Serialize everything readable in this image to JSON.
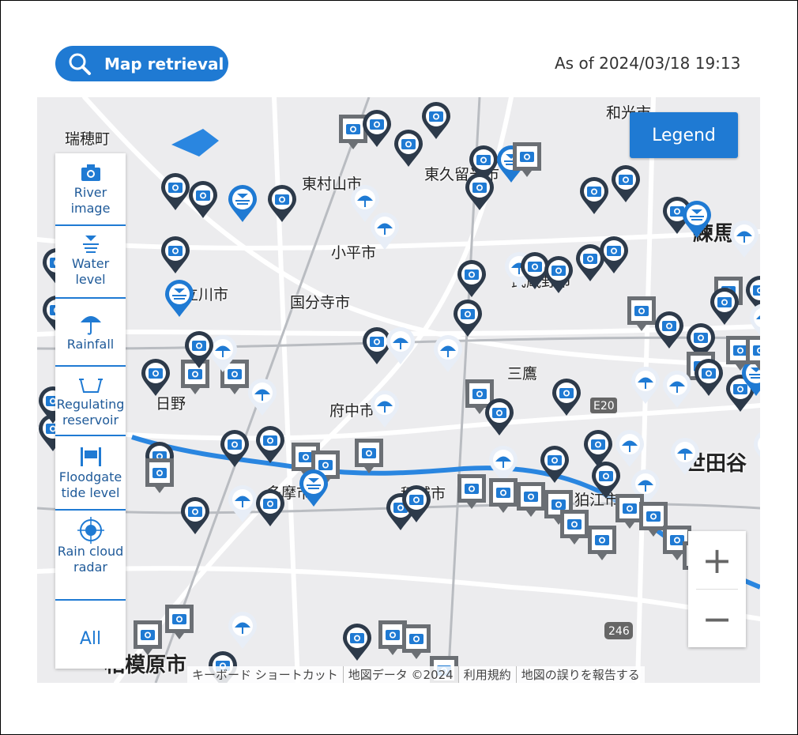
{
  "header": {
    "retrieval_label": "Map retrieval",
    "timestamp": "As of 2024/03/18 19:13"
  },
  "legend_button": "Legend",
  "filters": [
    {
      "label": "River image",
      "icon": "camera-icon"
    },
    {
      "label": "Water level",
      "icon": "water-level-icon"
    },
    {
      "label": "Rainfall",
      "icon": "umbrella-icon"
    },
    {
      "label": "Regulating reservoir",
      "icon": "reservoir-icon"
    },
    {
      "label": "Floodgate tide level",
      "icon": "floodgate-icon"
    },
    {
      "label": "Rain cloud radar",
      "icon": "radar-icon"
    },
    {
      "label": "All",
      "icon": ""
    }
  ],
  "zoom": {
    "in": "+",
    "out": "−"
  },
  "attribution": [
    "キーボード ショートカット",
    "地図データ ©2024",
    "利用規約",
    "地図の誤りを報告する"
  ],
  "places": [
    "瑞穂町",
    "東村山市",
    "東久留米市",
    "和光市",
    "小平市",
    "練馬",
    "立川市",
    "国分寺市",
    "武蔵野市",
    "三鷹",
    "府中市",
    "日野",
    "世田谷",
    "多摩市",
    "稲城市",
    "狛江市",
    "相模原市"
  ],
  "road_shields": [
    "E20",
    "246"
  ],
  "colors": {
    "accent": "#1f7ad3",
    "dark_marker": "#2d3a4a",
    "gray_marker": "#6b6f74",
    "water": "#2a86e0"
  }
}
